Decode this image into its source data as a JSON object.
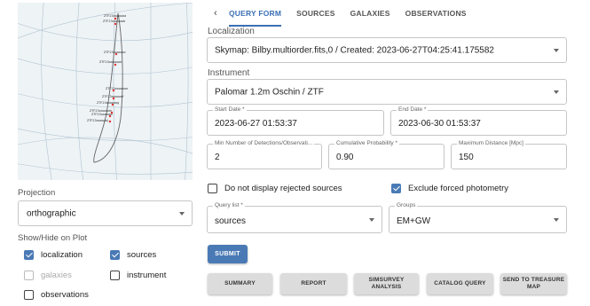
{
  "skymap": {
    "labels": [
      "ZTF23aaaaaaa",
      "ZTF23aaaaaab",
      "ZTF23aaaaaac",
      "ZTF23aaaaaad",
      "ZTF23aaaaaae",
      "ZTF23aaaaaaf",
      "ZTF23aaaaaag",
      "ZTF23aaaaaah",
      "ZTF23aaaaaai",
      "ZTF23aaaaaaj"
    ],
    "line_color": "#b0c4d0",
    "region_color": "#666666",
    "marker_color": "#e03030"
  },
  "projection": {
    "label": "Projection",
    "value": "orthographic"
  },
  "show_hide": {
    "label": "Show/Hide on Plot",
    "localization": "localization",
    "sources": "sources",
    "galaxies": "galaxies",
    "instrument": "instrument",
    "observations": "observations"
  },
  "tabs": {
    "back": "‹",
    "query_form": "QUERY FORM",
    "sources": "SOURCES",
    "galaxies": "GALAXIES",
    "observations": "OBSERVATIONS"
  },
  "form": {
    "localization_label": "Localization",
    "localization_value": "Skymap: Bilby.multiorder.fits,0 / Created: 2023-06-27T04:25:41.175582",
    "instrument_label": "Instrument",
    "instrument_value": "Palomar 1.2m Oschin / ZTF",
    "start_date_label": "Start Date *",
    "start_date_value": "2023-06-27 01:53:37",
    "end_date_label": "End Date *",
    "end_date_value": "2023-06-30 01:53:37",
    "min_detections_label": "Min Number of Detections/Observati...",
    "min_detections_value": "2",
    "cum_prob_label": "Cumulative Probability *",
    "cum_prob_value": "0.90",
    "max_dist_label": "Maximum Distance [Mpc]",
    "max_dist_value": "150",
    "no_rejected_label": "Do not display rejected sources",
    "exclude_forced_label": "Exclude forced photometry",
    "query_list_label": "Query list *",
    "query_list_value": "sources",
    "groups_label": "Groups",
    "groups_value": "EM+GW",
    "submit_label": "SUBMIT"
  },
  "buttons": {
    "summary": "SUMMARY",
    "report": "REPORT",
    "simsurvey": "SIMSURVEY ANALYSIS",
    "catalog_query": "CATALOG QUERY",
    "treasure_map": "SEND TO TREASURE MAP"
  },
  "colors": {
    "accent": "#3b6fb6",
    "checkbox": "#4a7ab5"
  }
}
